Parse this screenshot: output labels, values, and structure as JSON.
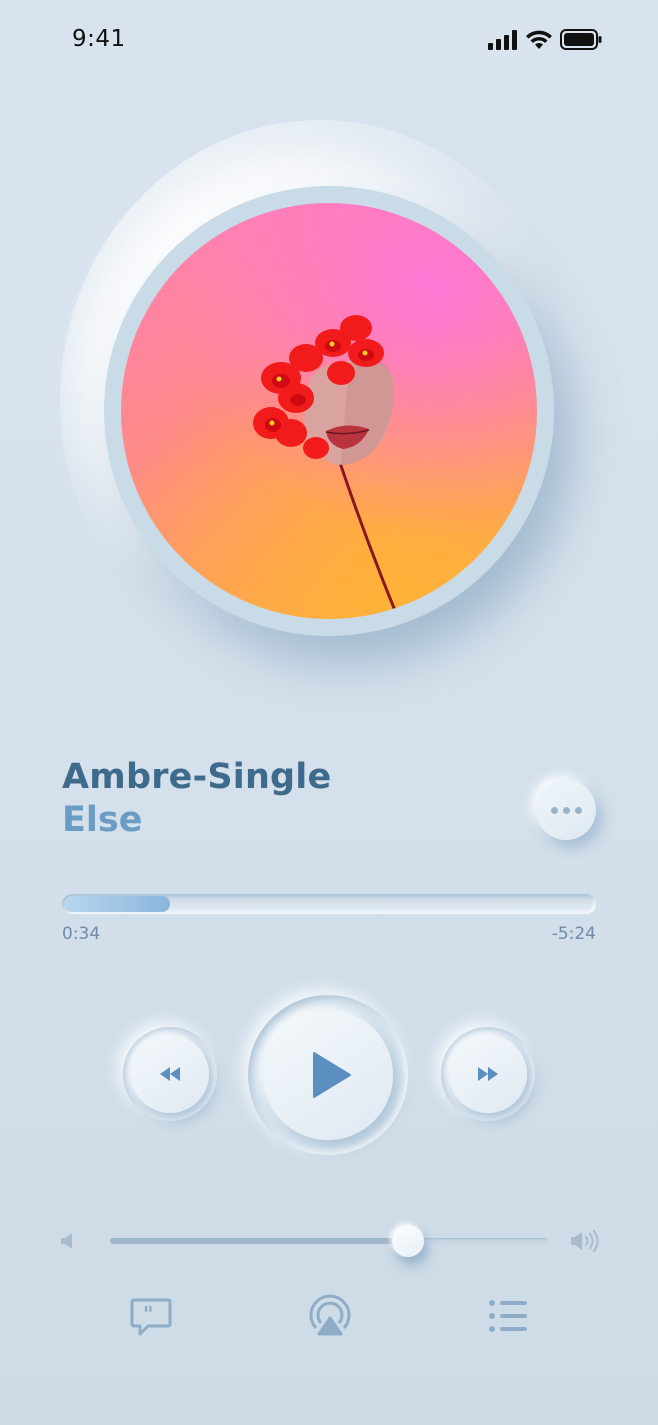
{
  "status_bar": {
    "time": "9:41",
    "icons": [
      "signal-icon",
      "wifi-icon",
      "battery-icon"
    ]
  },
  "album": {
    "art_description_icon": "album-art-flower-portrait",
    "gradient_colors": [
      "#ff7fb8",
      "#ff8a88",
      "#ffba3a"
    ]
  },
  "track": {
    "title": "Ambre-Single",
    "artist": "Else"
  },
  "more_button": {
    "icon": "more-dots-icon"
  },
  "progress": {
    "elapsed": "0:34",
    "remaining": "-5:24",
    "fraction": 0.2
  },
  "controls": {
    "rewind_icon": "rewind-icon",
    "play_icon": "play-icon",
    "forward_icon": "fast-forward-icon"
  },
  "volume": {
    "level": 0.68,
    "low_icon": "speaker-low-icon",
    "high_icon": "speaker-high-icon"
  },
  "bottom_bar": {
    "items": [
      "lyrics-icon",
      "airplay-icon",
      "queue-list-icon"
    ]
  },
  "colors": {
    "accent": "#5b8fbf",
    "title": "#3e6a8c",
    "artist": "#6b9cc4",
    "background": "#d9e3ee"
  }
}
